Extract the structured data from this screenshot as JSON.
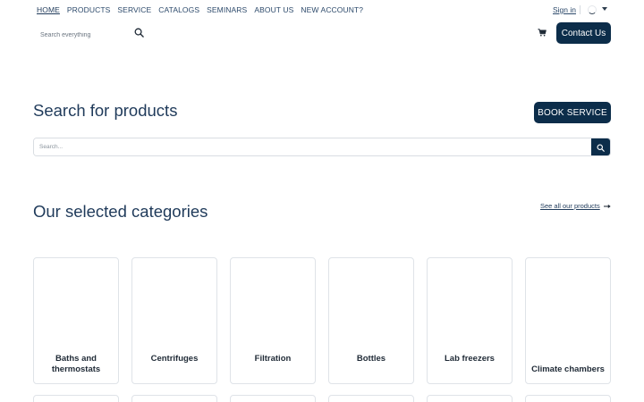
{
  "nav": {
    "items": [
      "HOME",
      "PRODUCTS",
      "SERVICE",
      "CATALOGS",
      "SEMINARS",
      "ABOUT US",
      "NEW ACCOUNT?"
    ]
  },
  "header": {
    "signin_label": "Sign in",
    "search_placeholder": "Search everything",
    "contact_label": "Contact Us",
    "cart_icon": "cart-icon",
    "language_icon": "loading-icon"
  },
  "search_section": {
    "title": "Search for products",
    "book_label": "BOOK SERVICE",
    "placeholder": "Search..."
  },
  "categories_section": {
    "title": "Our selected categories",
    "see_all_label": "See all our products",
    "items": [
      {
        "label": "Baths and thermostats"
      },
      {
        "label": "Centrifuges"
      },
      {
        "label": "Filtration"
      },
      {
        "label": "Bottles"
      },
      {
        "label": "Lab freezers"
      },
      {
        "label": "Climate chambers"
      }
    ]
  },
  "colors": {
    "primary": "#0c2d4a",
    "heading": "#1f3a5a",
    "border": "#dfe3e8"
  }
}
